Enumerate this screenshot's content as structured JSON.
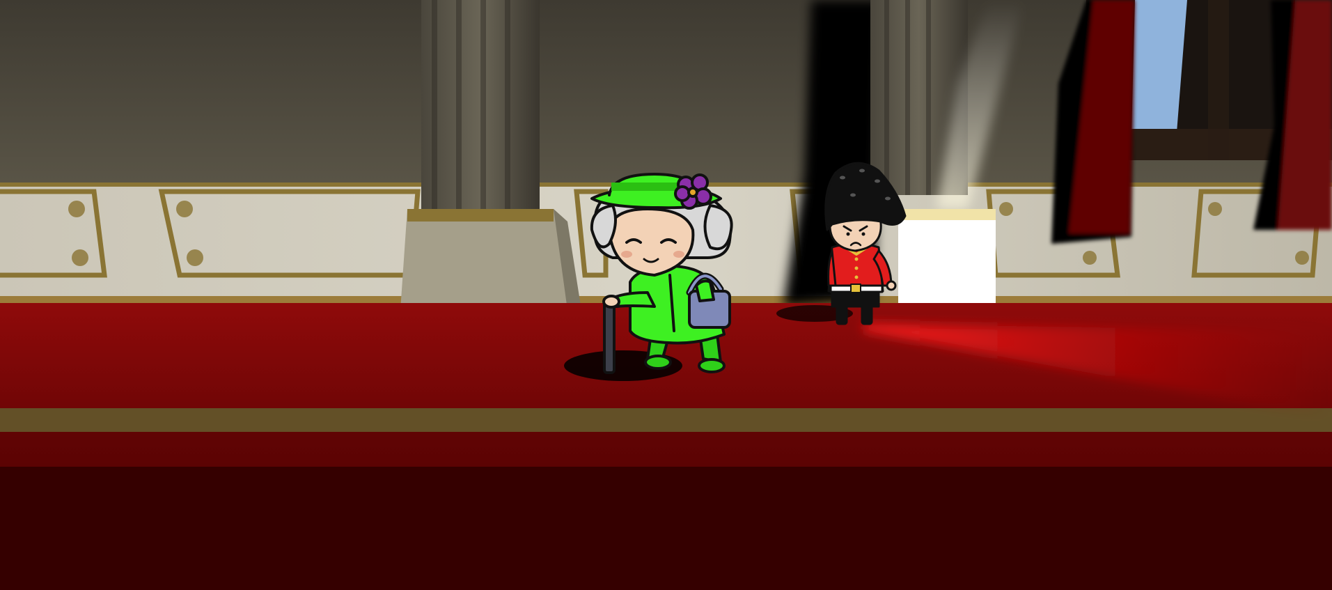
{
  "scene": {
    "kind": "3d-game-view",
    "location": "palace-hallway",
    "characters": [
      {
        "id": "queen",
        "role": "player",
        "outfit_color": "#33e81a",
        "hat_flower_color": "#8a2fa8"
      },
      {
        "id": "guard",
        "role": "enemy",
        "tunic_color": "#d91818",
        "hat_color": "#111111"
      }
    ]
  },
  "colors": {
    "wall": "#4e4a40",
    "wall_dark": "#3a372f",
    "wainscot": "#d3cfc1",
    "gold_trim": "#8a7434",
    "carpet": "#8e0a0a",
    "carpet_dark": "#3a0000",
    "carpet_stripe": "#635027",
    "window_sky": "#8fb3dc",
    "curtain": "#6e0808",
    "vision_cone": "#ff1a1a"
  }
}
